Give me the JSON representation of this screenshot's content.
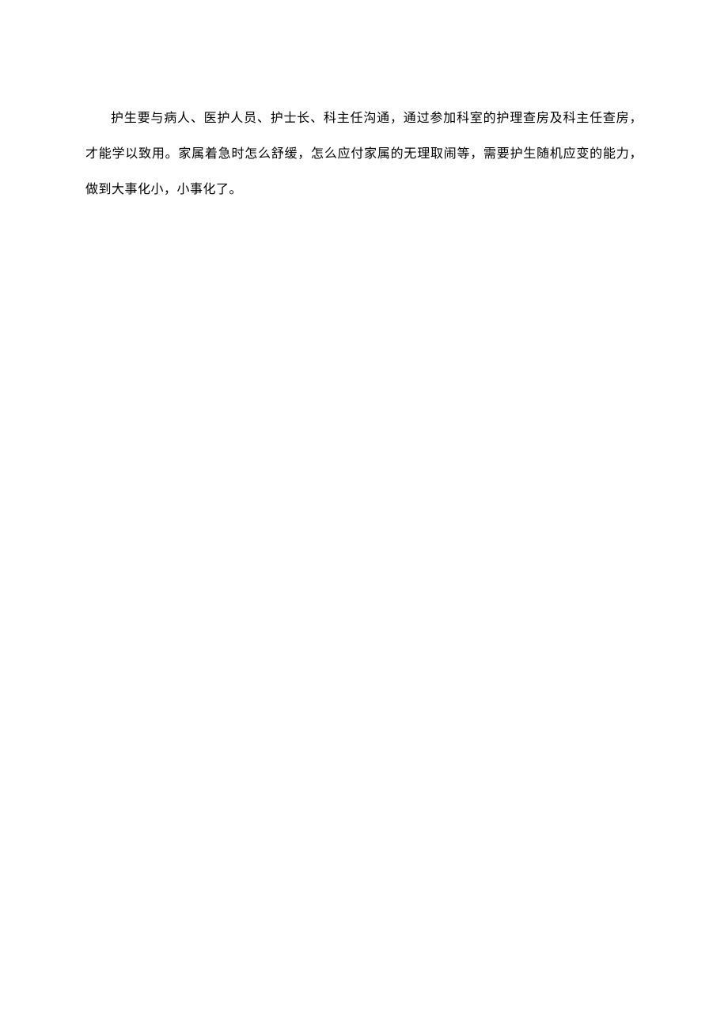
{
  "document": {
    "paragraph": "护生要与病人、医护人员、护士长、科主任沟通，通过参加科室的护理查房及科主任查房，才能学以致用。家属着急时怎么舒缓，怎么应付家属的无理取闹等，需要护生随机应变的能力，做到大事化小，小事化了。"
  }
}
